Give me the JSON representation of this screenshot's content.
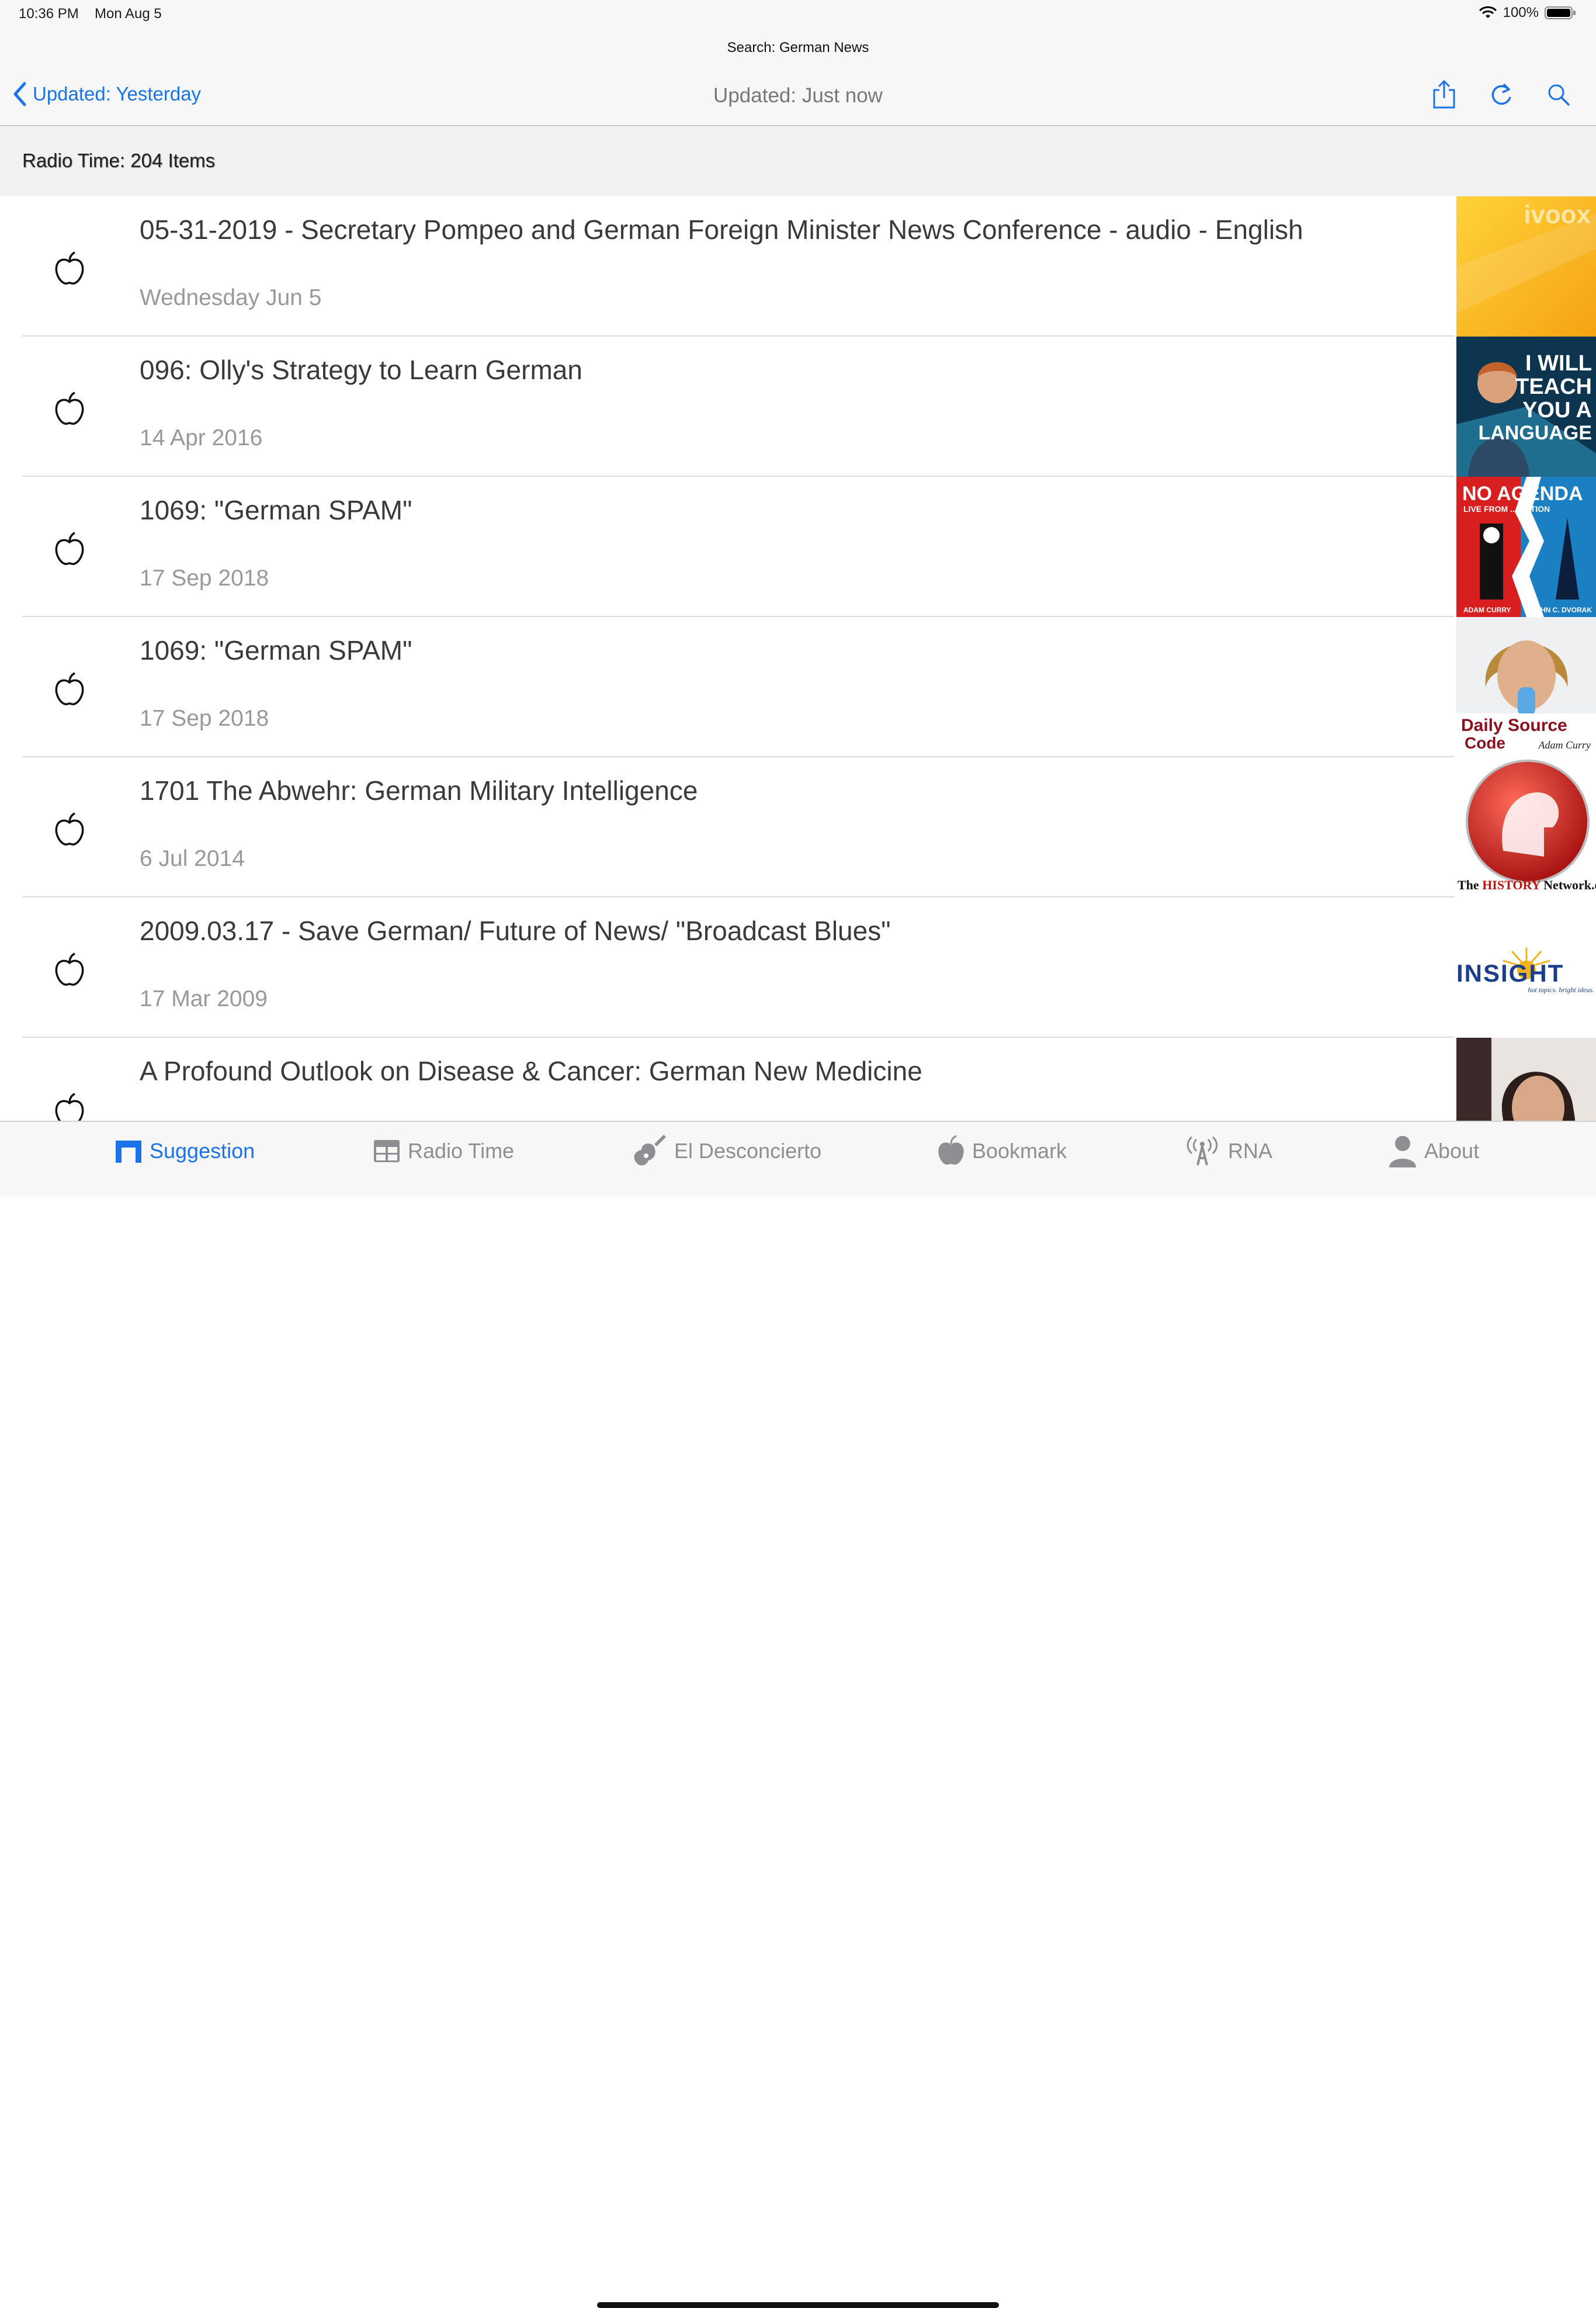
{
  "status": {
    "time": "10:36 PM",
    "date": "Mon Aug 5",
    "battery": "100%"
  },
  "nav": {
    "search_title": "Search: German News",
    "back_label": "Updated: Yesterday",
    "title": "Updated: Just now"
  },
  "section": {
    "header": "Radio Time: 204 Items"
  },
  "items": [
    {
      "title": "05-31-2019 - Secretary Pompeo and German Foreign Minister News Conference - audio - English",
      "date": "Wednesday Jun 5",
      "thumb": "ivoox"
    },
    {
      "title": "096: Olly's Strategy to Learn German",
      "date": "14 Apr 2016",
      "thumb": "iwillteach"
    },
    {
      "title": "1069: \"German SPAM\"",
      "date": "17 Sep 2018",
      "thumb": "noagenda"
    },
    {
      "title": "1069: \"German SPAM\"",
      "date": "17 Sep 2018",
      "thumb": "dailysource"
    },
    {
      "title": "1701 The Abwehr: German Military Intelligence",
      "date": "6 Jul 2014",
      "thumb": "historynetwork"
    },
    {
      "title": "2009.03.17 - Save German/ Future of News/ \"Broadcast Blues\"",
      "date": "17 Mar 2009",
      "thumb": "insight"
    },
    {
      "title": "A Profound Outlook on Disease & Cancer: German New Medicine",
      "date": "",
      "thumb": "portrait"
    }
  ],
  "thumb_text": {
    "ivoox": "ivoox",
    "iwillteach": [
      "I WILL",
      "TEACH",
      "YOU A",
      "LANGUAGE"
    ],
    "noagenda": {
      "main": "NO AGENDA",
      "sub": "LIVE FROM ... NATION",
      "left": "ADAM CURRY",
      "right": "JOHN C. DVORAK"
    },
    "dailysource": {
      "line1": "Daily Source",
      "line2": "Code",
      "sig": "Adam Curry"
    },
    "history": {
      "the": "The",
      "history": "HISTORY",
      "network": "Network.org"
    },
    "insight": {
      "main": "INSIGHT",
      "tag": "hot topics. bright ideas."
    }
  },
  "tabs": [
    {
      "label": "Suggestion",
      "icon": "suggestion-icon",
      "active": true
    },
    {
      "label": "Radio Time",
      "icon": "grid-icon",
      "active": false
    },
    {
      "label": "El Desconcierto",
      "icon": "guitar-icon",
      "active": false
    },
    {
      "label": "Bookmark",
      "icon": "apple-icon",
      "active": false
    },
    {
      "label": "RNA",
      "icon": "antenna-icon",
      "active": false
    },
    {
      "label": "About",
      "icon": "person-icon",
      "active": false
    }
  ],
  "colors": {
    "accent": "#1a73e8",
    "inactive": "#8e8e93",
    "separator": "#dcdcdc"
  }
}
